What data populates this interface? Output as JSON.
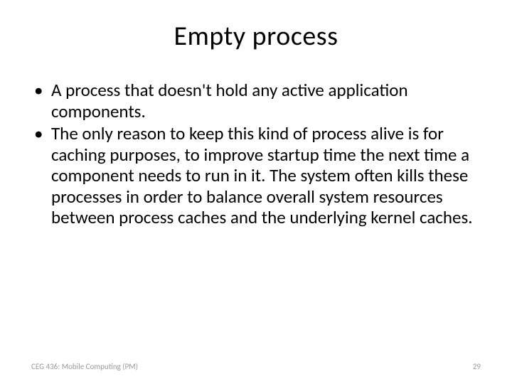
{
  "slide": {
    "title": "Empty process",
    "bullets": [
      "A process that doesn't hold any active application components.",
      "The only reason to keep this kind of process alive is for caching purposes, to improve startup time the next time a component needs to run in it. The system often kills these processes in order to balance overall system resources between process caches and the underlying kernel caches."
    ],
    "footer_left": "CEG 436: Mobile Computing (PM)",
    "footer_right": "29"
  }
}
